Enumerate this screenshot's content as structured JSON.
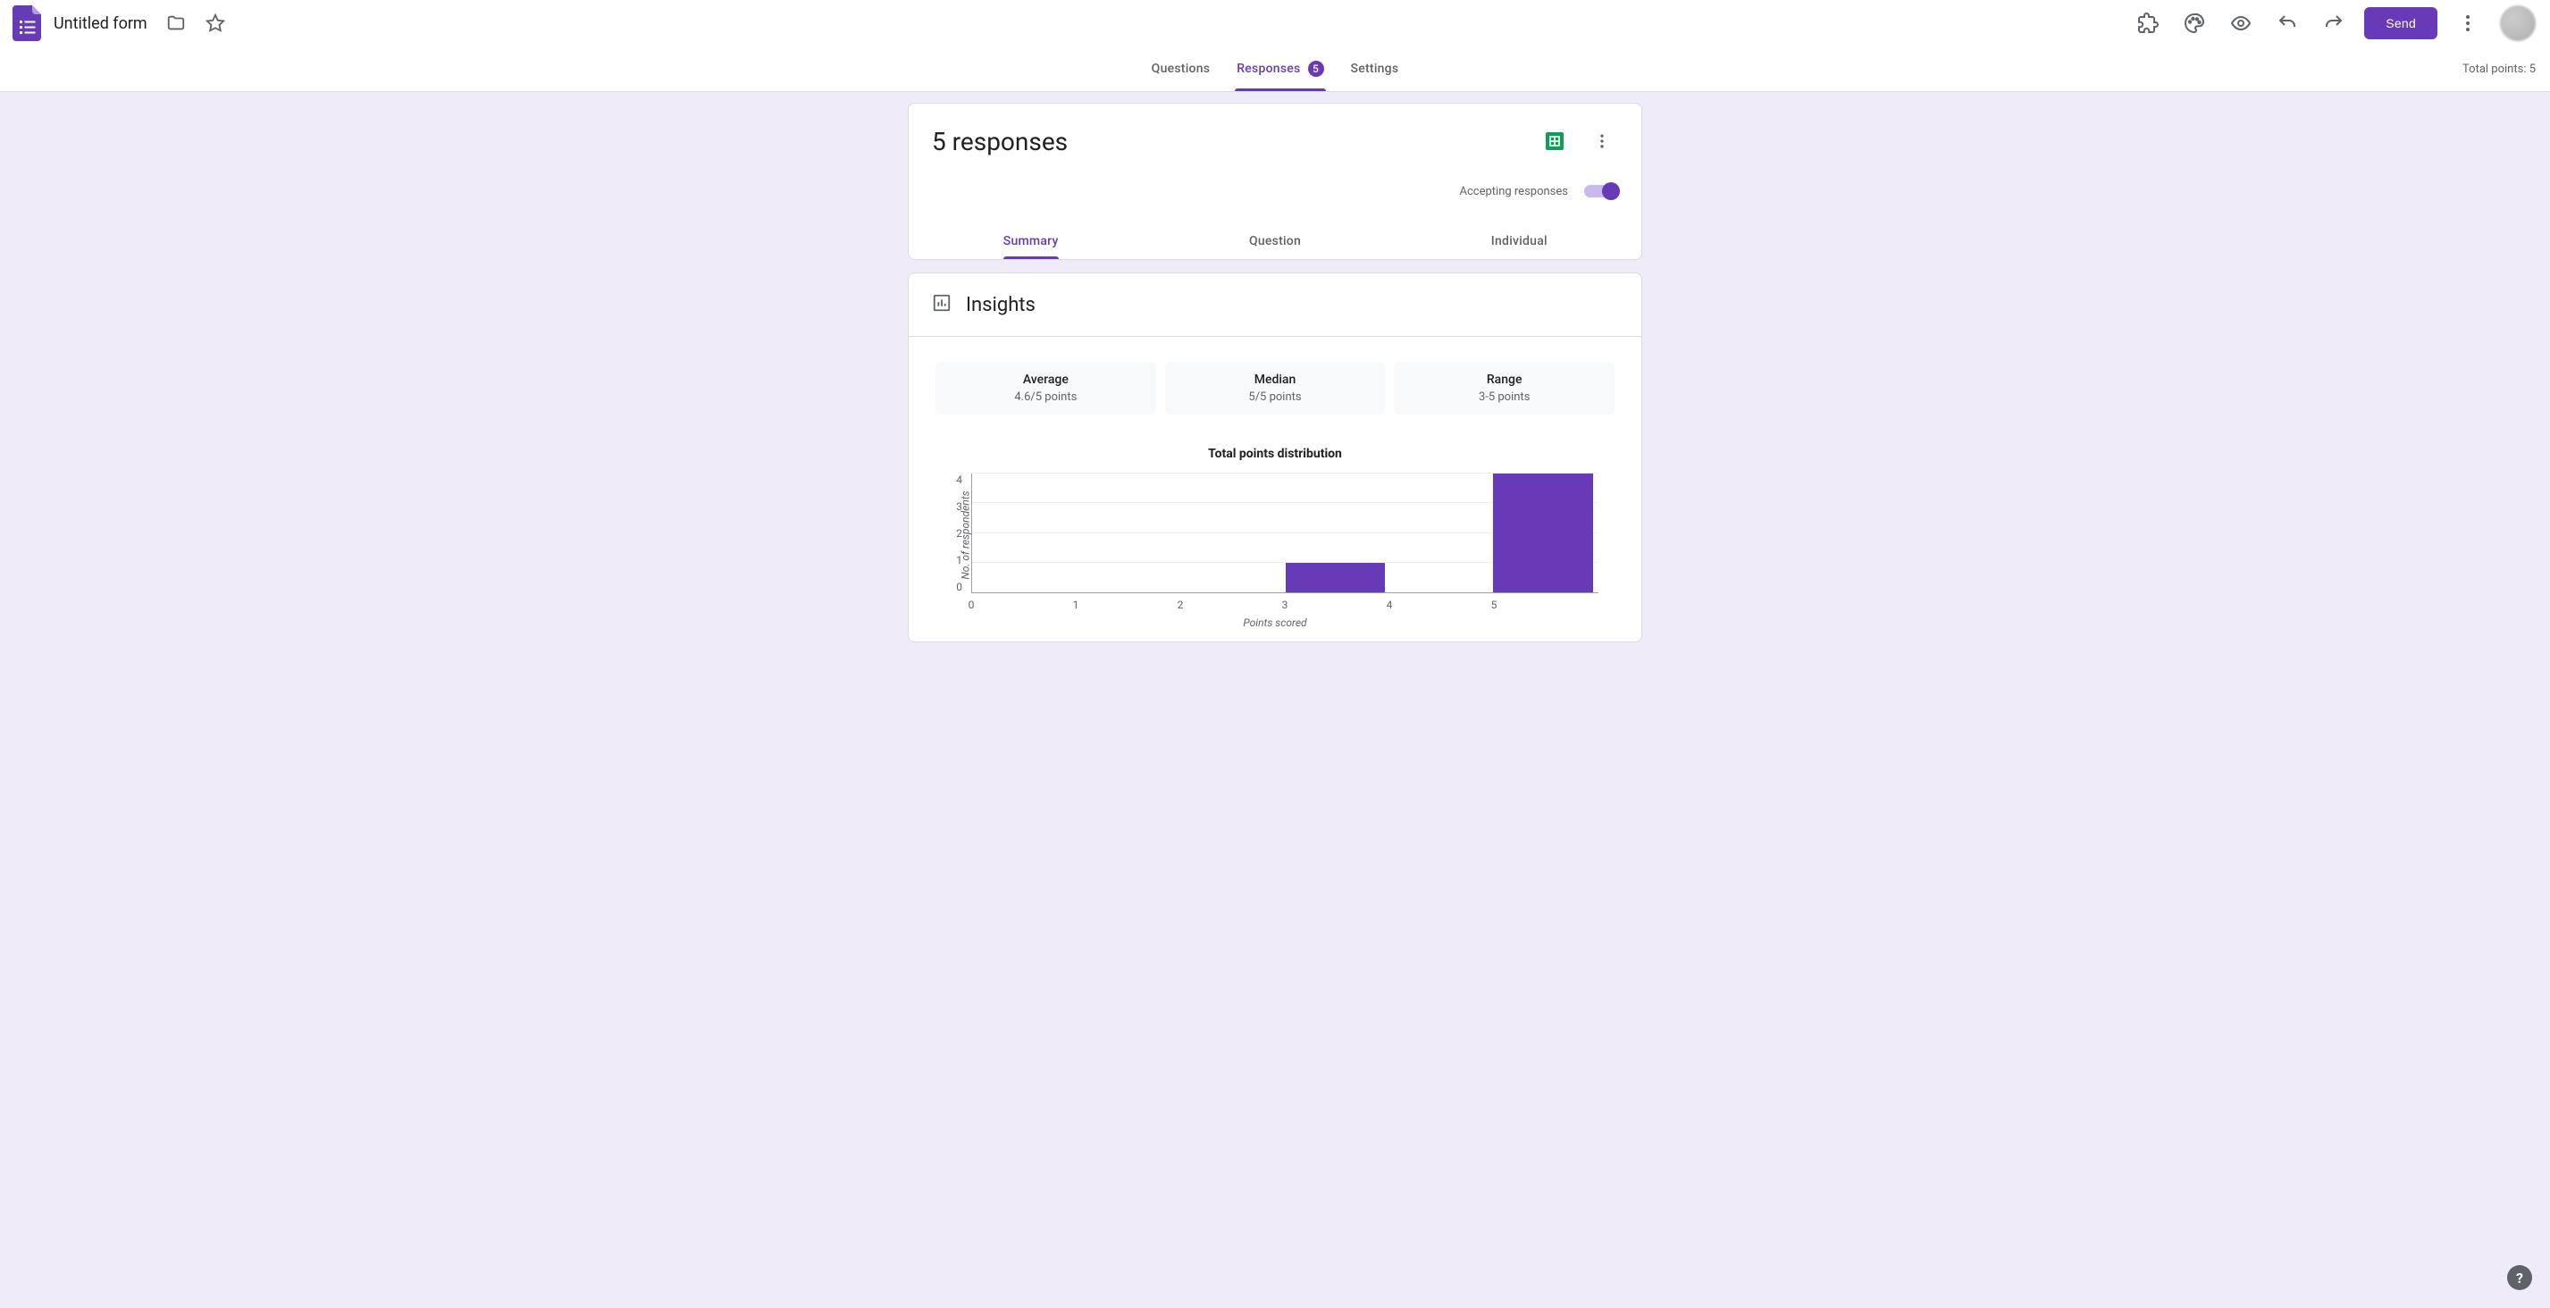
{
  "header": {
    "form_title": "Untitled form",
    "send_label": "Send"
  },
  "tabs": {
    "questions": "Questions",
    "responses": "Responses",
    "responses_count": "5",
    "settings": "Settings",
    "total_points_label": "Total points: 5"
  },
  "responses_card": {
    "title": "5 responses",
    "accepting_label": "Accepting responses",
    "sub_tabs": {
      "summary": "Summary",
      "question": "Question",
      "individual": "Individual"
    }
  },
  "insights": {
    "title": "Insights",
    "stats": {
      "average_label": "Average",
      "average_value": "4.6/5 points",
      "median_label": "Median",
      "median_value": "5/5 points",
      "range_label": "Range",
      "range_value": "3-5 points"
    }
  },
  "chart_data": {
    "type": "bar",
    "title": "Total points distribution",
    "xlabel": "Points scored",
    "ylabel": "No. of respondents",
    "categories": [
      0,
      1,
      2,
      3,
      4,
      5
    ],
    "values": [
      0,
      0,
      0,
      1,
      0,
      4
    ],
    "ylim": [
      0,
      4
    ],
    "yticks": [
      0,
      1,
      2,
      3,
      4
    ]
  },
  "help": "?"
}
